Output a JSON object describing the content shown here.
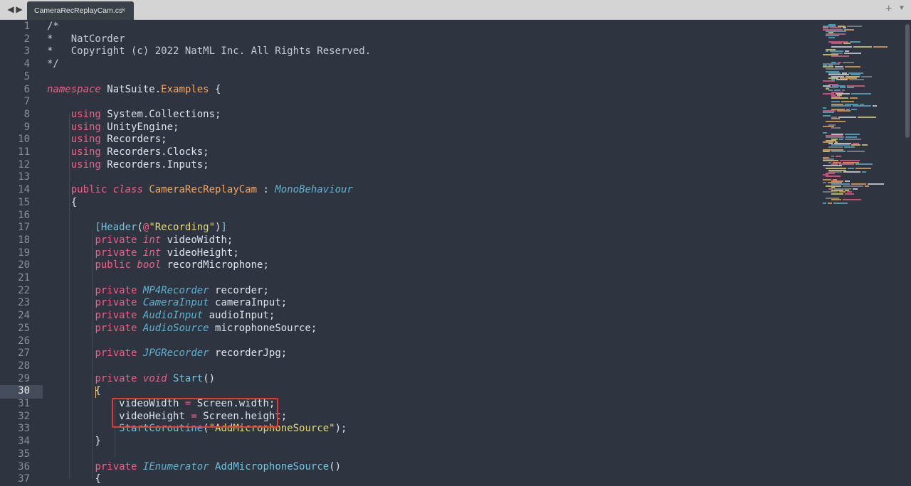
{
  "tab": {
    "filename": "CameraRecReplayCam.cs",
    "close_glyph": "×",
    "nav_left": "◀",
    "nav_right": "▶",
    "new_tab": "+",
    "menu": "▼"
  },
  "editor": {
    "active_line": 30,
    "line_numbers": [
      "1",
      "2",
      "3",
      "4",
      "5",
      "6",
      "7",
      "8",
      "9",
      "10",
      "11",
      "12",
      "13",
      "14",
      "15",
      "16",
      "17",
      "18",
      "19",
      "20",
      "21",
      "22",
      "23",
      "24",
      "25",
      "26",
      "27",
      "28",
      "29",
      "30",
      "31",
      "32",
      "33",
      "34",
      "35",
      "36",
      "37"
    ],
    "lines": [
      {
        "indent": "",
        "tokens": [
          {
            "t": "/*",
            "c": "cm"
          }
        ]
      },
      {
        "indent": "",
        "tokens": [
          {
            "t": "*   NatCorder",
            "c": "cm"
          }
        ]
      },
      {
        "indent": "",
        "tokens": [
          {
            "t": "*   Copyright (c) 2022 NatML Inc. All Rights Reserved.",
            "c": "cm"
          }
        ]
      },
      {
        "indent": "",
        "tokens": [
          {
            "t": "*/",
            "c": "cm"
          }
        ]
      },
      {
        "indent": "",
        "tokens": []
      },
      {
        "indent": "",
        "tokens": [
          {
            "t": "namespace",
            "c": "kw it"
          },
          {
            "t": " NatSuite.",
            "c": ""
          },
          {
            "t": "Examples",
            "c": "nm"
          },
          {
            "t": " {",
            "c": ""
          }
        ]
      },
      {
        "indent": "",
        "tokens": []
      },
      {
        "indent": "    ",
        "tokens": [
          {
            "t": "using",
            "c": "kw"
          },
          {
            "t": " System.Collections;",
            "c": ""
          }
        ]
      },
      {
        "indent": "    ",
        "tokens": [
          {
            "t": "using",
            "c": "kw"
          },
          {
            "t": " UnityEngine;",
            "c": ""
          }
        ]
      },
      {
        "indent": "    ",
        "tokens": [
          {
            "t": "using",
            "c": "kw"
          },
          {
            "t": " Recorders;",
            "c": ""
          }
        ]
      },
      {
        "indent": "    ",
        "tokens": [
          {
            "t": "using",
            "c": "kw"
          },
          {
            "t": " Recorders.Clocks;",
            "c": ""
          }
        ]
      },
      {
        "indent": "    ",
        "tokens": [
          {
            "t": "using",
            "c": "kw"
          },
          {
            "t": " Recorders.Inputs;",
            "c": ""
          }
        ]
      },
      {
        "indent": "",
        "tokens": []
      },
      {
        "indent": "    ",
        "tokens": [
          {
            "t": "public",
            "c": "kw"
          },
          {
            "t": " ",
            "c": ""
          },
          {
            "t": "class",
            "c": "kw it"
          },
          {
            "t": " ",
            "c": ""
          },
          {
            "t": "CameraRecReplayCam",
            "c": "nm"
          },
          {
            "t": " : ",
            "c": ""
          },
          {
            "t": "MonoBehaviour",
            "c": "ty"
          }
        ]
      },
      {
        "indent": "    ",
        "tokens": [
          {
            "t": "{",
            "c": ""
          }
        ]
      },
      {
        "indent": "",
        "tokens": []
      },
      {
        "indent": "        ",
        "tokens": [
          {
            "t": "[",
            "c": "at"
          },
          {
            "t": "Header",
            "c": "at"
          },
          {
            "t": "(",
            "c": ""
          },
          {
            "t": "@",
            "c": "op"
          },
          {
            "t": "\"Recording\"",
            "c": "st"
          },
          {
            "t": ")",
            "c": ""
          },
          {
            "t": "]",
            "c": "at"
          }
        ]
      },
      {
        "indent": "        ",
        "tokens": [
          {
            "t": "private",
            "c": "kw"
          },
          {
            "t": " ",
            "c": ""
          },
          {
            "t": "int",
            "c": "kw it"
          },
          {
            "t": " videoWidth;",
            "c": ""
          }
        ]
      },
      {
        "indent": "        ",
        "tokens": [
          {
            "t": "private",
            "c": "kw"
          },
          {
            "t": " ",
            "c": ""
          },
          {
            "t": "int",
            "c": "kw it"
          },
          {
            "t": " videoHeight;",
            "c": ""
          }
        ]
      },
      {
        "indent": "        ",
        "tokens": [
          {
            "t": "public",
            "c": "kw"
          },
          {
            "t": " ",
            "c": ""
          },
          {
            "t": "bool",
            "c": "kw it"
          },
          {
            "t": " recordMicrophone;",
            "c": ""
          }
        ]
      },
      {
        "indent": "",
        "tokens": []
      },
      {
        "indent": "        ",
        "tokens": [
          {
            "t": "private",
            "c": "kw"
          },
          {
            "t": " ",
            "c": ""
          },
          {
            "t": "MP4Recorder",
            "c": "ty"
          },
          {
            "t": " recorder;",
            "c": ""
          }
        ]
      },
      {
        "indent": "        ",
        "tokens": [
          {
            "t": "private",
            "c": "kw"
          },
          {
            "t": " ",
            "c": ""
          },
          {
            "t": "CameraInput",
            "c": "ty"
          },
          {
            "t": " cameraInput;",
            "c": ""
          }
        ]
      },
      {
        "indent": "        ",
        "tokens": [
          {
            "t": "private",
            "c": "kw"
          },
          {
            "t": " ",
            "c": ""
          },
          {
            "t": "AudioInput",
            "c": "ty"
          },
          {
            "t": " audioInput;",
            "c": ""
          }
        ]
      },
      {
        "indent": "        ",
        "tokens": [
          {
            "t": "private",
            "c": "kw"
          },
          {
            "t": " ",
            "c": ""
          },
          {
            "t": "AudioSource",
            "c": "ty"
          },
          {
            "t": " microphoneSource;",
            "c": ""
          }
        ]
      },
      {
        "indent": "",
        "tokens": []
      },
      {
        "indent": "        ",
        "tokens": [
          {
            "t": "private",
            "c": "kw"
          },
          {
            "t": " ",
            "c": ""
          },
          {
            "t": "JPGRecorder",
            "c": "ty"
          },
          {
            "t": " recorderJpg;",
            "c": ""
          }
        ]
      },
      {
        "indent": "",
        "tokens": []
      },
      {
        "indent": "        ",
        "tokens": [
          {
            "t": "private",
            "c": "kw"
          },
          {
            "t": " ",
            "c": ""
          },
          {
            "t": "void",
            "c": "kw it"
          },
          {
            "t": " ",
            "c": ""
          },
          {
            "t": "Start",
            "c": "fn"
          },
          {
            "t": "()",
            "c": ""
          }
        ]
      },
      {
        "indent": "        ",
        "tokens": [
          {
            "t": "{",
            "c": ""
          }
        ]
      },
      {
        "indent": "            ",
        "tokens": [
          {
            "t": "videoWidth ",
            "c": ""
          },
          {
            "t": "=",
            "c": "op"
          },
          {
            "t": " Screen.width;",
            "c": ""
          }
        ]
      },
      {
        "indent": "            ",
        "tokens": [
          {
            "t": "videoHeight ",
            "c": ""
          },
          {
            "t": "=",
            "c": "op"
          },
          {
            "t": " Screen.height;",
            "c": ""
          }
        ]
      },
      {
        "indent": "            ",
        "tokens": [
          {
            "t": "StartCoroutine",
            "c": "fn"
          },
          {
            "t": "(",
            "c": ""
          },
          {
            "t": "\"AddMicrophoneSource\"",
            "c": "st"
          },
          {
            "t": ");",
            "c": ""
          }
        ]
      },
      {
        "indent": "        ",
        "tokens": [
          {
            "t": "}",
            "c": ""
          }
        ]
      },
      {
        "indent": "",
        "tokens": []
      },
      {
        "indent": "        ",
        "tokens": [
          {
            "t": "private",
            "c": "kw"
          },
          {
            "t": " ",
            "c": ""
          },
          {
            "t": "IEnumerator",
            "c": "ty"
          },
          {
            "t": " ",
            "c": ""
          },
          {
            "t": "AddMicrophoneSource",
            "c": "fn"
          },
          {
            "t": "()",
            "c": ""
          }
        ]
      },
      {
        "indent": "        ",
        "tokens": [
          {
            "t": "{",
            "c": ""
          }
        ]
      }
    ]
  },
  "colors": {
    "background": "#2e3440",
    "keyword": "#f05f88",
    "type": "#5fb3d0",
    "name": "#f5a65b",
    "string": "#e6db74",
    "highlight": "#e53935"
  }
}
